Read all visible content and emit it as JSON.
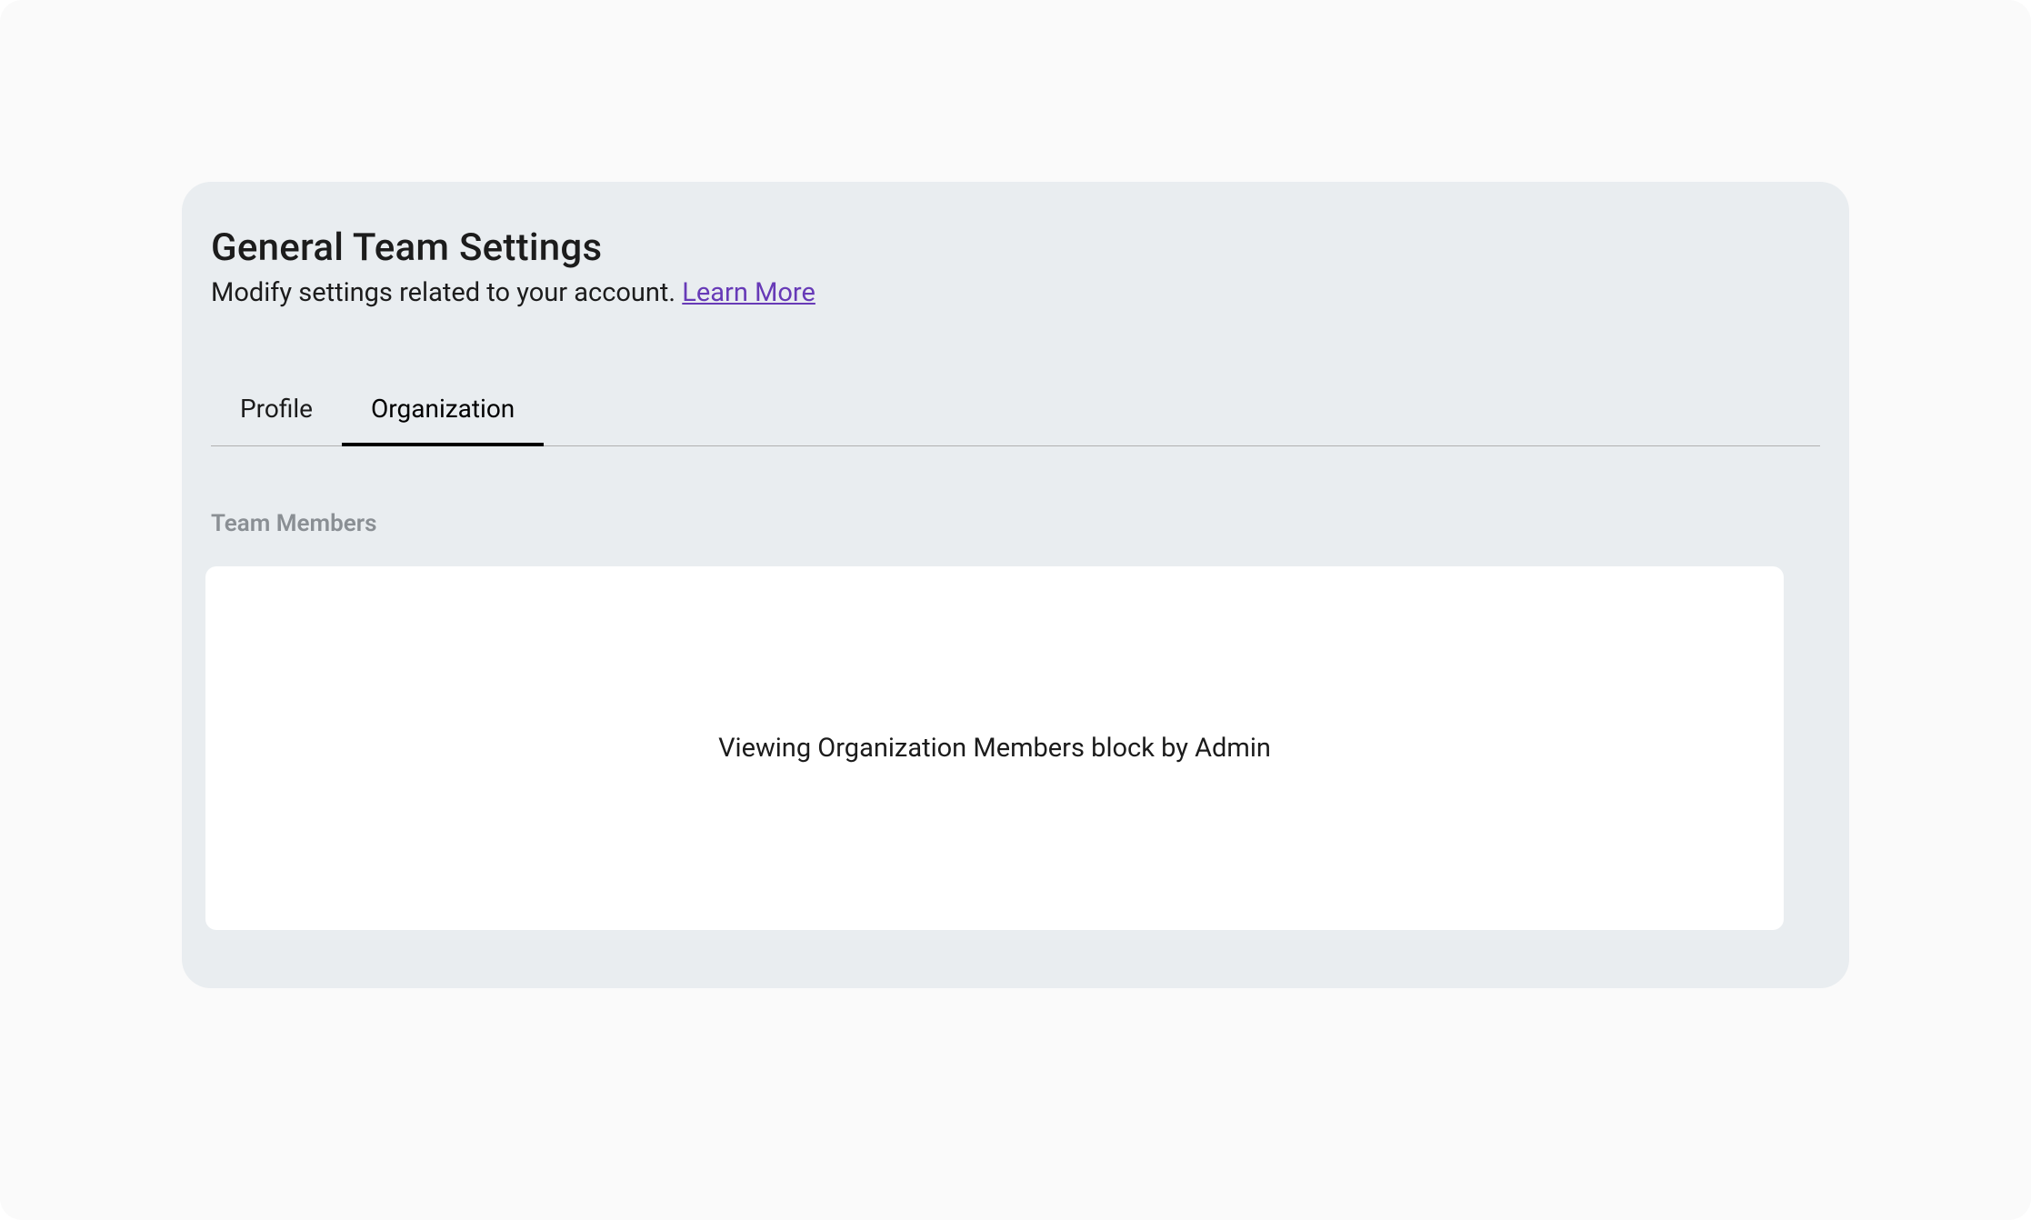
{
  "header": {
    "title": "General Team Settings",
    "subtitle": "Modify settings related to your account. ",
    "learnMoreLabel": "Learn More"
  },
  "tabs": {
    "profile": {
      "label": "Profile"
    },
    "organization": {
      "label": "Organization"
    }
  },
  "section": {
    "label": "Team Members"
  },
  "content": {
    "message": "Viewing Organization Members block by Admin"
  }
}
